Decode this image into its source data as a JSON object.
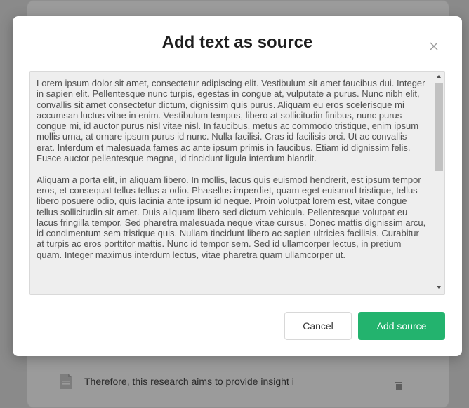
{
  "background": {
    "row_text": "Therefore, this research aims to provide insight i"
  },
  "modal": {
    "title": "Add text as source",
    "close_icon": "close-icon",
    "text_content": "Lorem ipsum dolor sit amet, consectetur adipiscing elit. Vestibulum sit amet faucibus dui. Integer in sapien elit. Pellentesque nunc turpis, egestas in congue at, vulputate a purus. Nunc nibh elit, convallis sit amet consectetur dictum, dignissim quis purus. Aliquam eu eros scelerisque mi accumsan luctus vitae in enim. Vestibulum tempus, libero at sollicitudin finibus, nunc purus congue mi, id auctor purus nisl vitae nisl. In faucibus, metus ac commodo tristique, enim ipsum mollis urna, at ornare ipsum purus id nunc. Nulla facilisi. Cras id facilisis orci. Ut ac convallis erat. Interdum et malesuada fames ac ante ipsum primis in faucibus. Etiam id dignissim felis. Fusce auctor pellentesque magna, id tincidunt ligula interdum blandit.\n\nAliquam a porta elit, in aliquam libero. In mollis, lacus quis euismod hendrerit, est ipsum tempor eros, et consequat tellus tellus a odio. Phasellus imperdiet, quam eget euismod tristique, tellus libero posuere odio, quis lacinia ante ipsum id neque. Proin volutpat lorem est, vitae congue tellus sollicitudin sit amet. Duis aliquam libero sed dictum vehicula. Pellentesque volutpat eu lacus fringilla tempor. Sed pharetra malesuada neque vitae cursus. Donec mattis dignissim arcu, id condimentum sem tristique quis. Nullam tincidunt libero ac sapien ultricies facilisis. Curabitur at turpis ac eros porttitor mattis. Nunc id tempor sem. Sed id ullamcorper lectus, in pretium quam. Integer maximus interdum lectus, vitae pharetra quam ullamcorper ut.",
    "cancel_label": "Cancel",
    "add_label": "Add source",
    "accent_color": "#23b36e"
  }
}
